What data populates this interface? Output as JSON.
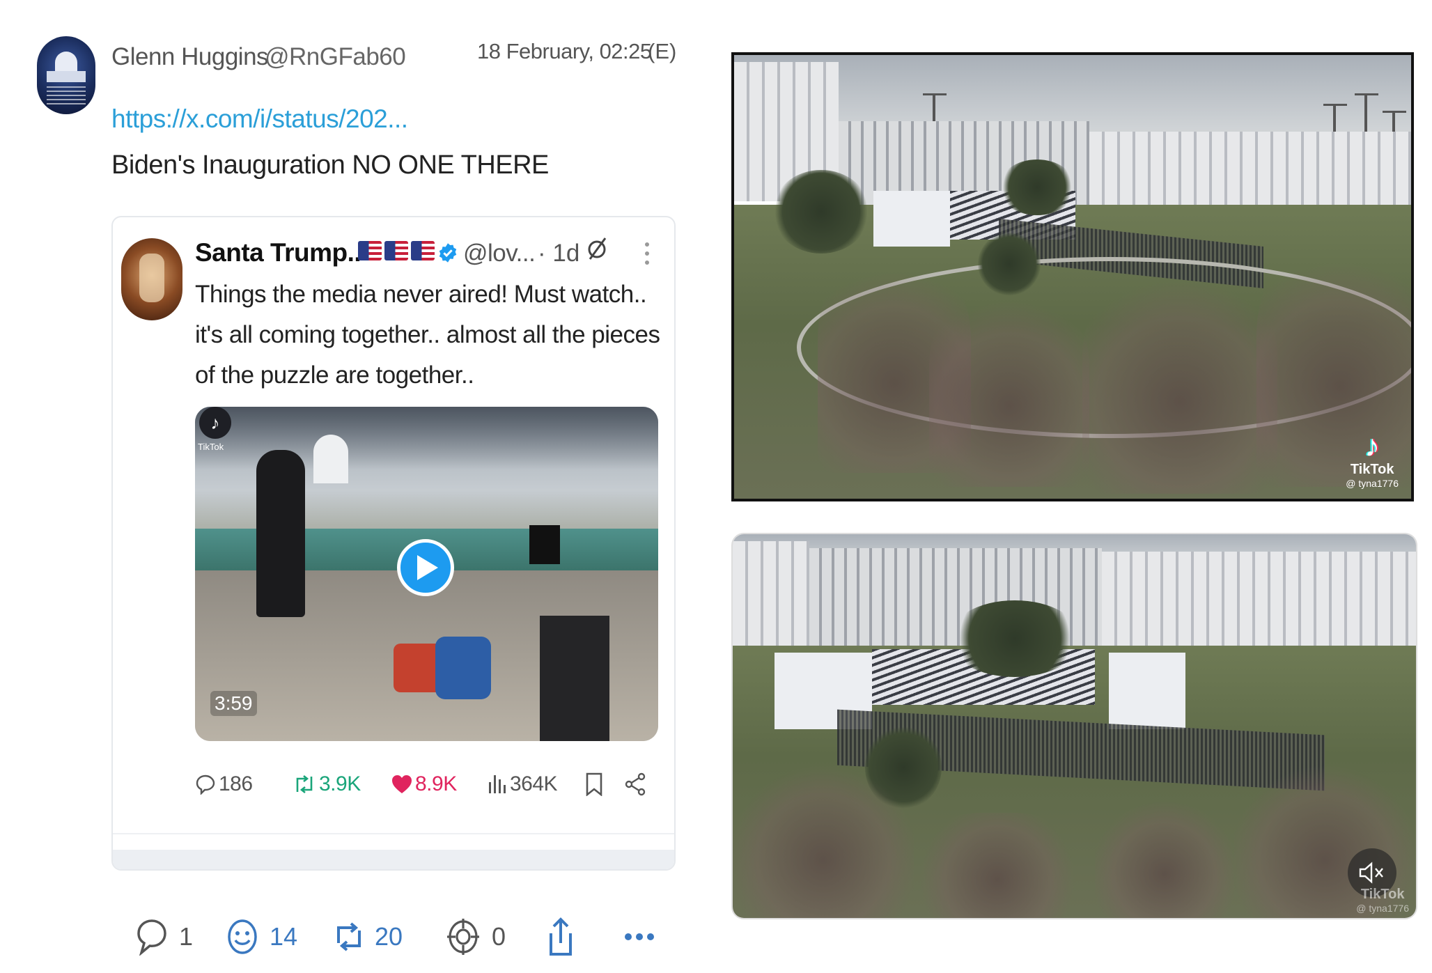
{
  "post": {
    "author_name": "Glenn Huggins",
    "author_handle": "@RnGFab60",
    "timestamp": "18 February, 02:25",
    "edited_flag": "(E)",
    "link": "https://x.com/i/status/202...",
    "text": "Biden's Inauguration NO ONE THERE",
    "avatar_icon": "capitol-avatar-icon"
  },
  "embedded_tweet": {
    "display_name": "Santa Trump..",
    "flags": [
      "us-flag-icon",
      "us-flag-icon",
      "us-flag-icon"
    ],
    "verified_icon": "verified-badge-icon",
    "handle": "@lov...",
    "age": "· 1d",
    "grok_icon": "grok-icon",
    "text": "Things the media never aired! Must watch.. it's all coming together.. almost all the pieces of the puzzle are together..",
    "video": {
      "duration": "3:59",
      "watermark_brand": "TikTok",
      "play_icon": "play-icon"
    },
    "actions": {
      "replies": "186",
      "reposts": "3.9K",
      "likes": "8.9K",
      "views": "364K"
    }
  },
  "post_actions": {
    "comments": "1",
    "reactions": "14",
    "reposts": "20",
    "targets": "0"
  },
  "photos": {
    "top": {
      "brand": "TikTok",
      "user": "@ tyna1776"
    },
    "bottom": {
      "brand": "TikTok",
      "user": "@ tyna1776",
      "mute_icon": "mute-icon"
    }
  },
  "colors": {
    "link": "#2b9fd8",
    "repost_green": "#1aa57a",
    "like_pink": "#e0245e",
    "action_blue": "#3a78c0",
    "play_blue": "#1d9bf0"
  }
}
